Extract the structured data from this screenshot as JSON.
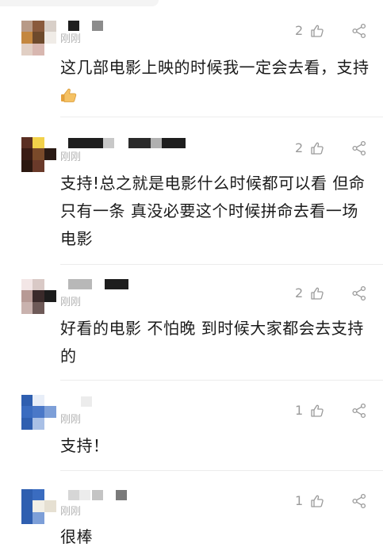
{
  "comments": [
    {
      "time": "刚刚",
      "likes": "2",
      "content": "这几部电影上映的时候我一定会去看，支持"
    },
    {
      "time": "刚刚",
      "likes": "2",
      "content": "支持!总之就是电影什么时候都可以看 但命只有一条 真没必要这个时候拼命去看一场电影"
    },
    {
      "time": "刚刚",
      "likes": "2",
      "content": "好看的电影 不怕晚 到时候大家都会去支持的"
    },
    {
      "time": "刚刚",
      "likes": "1",
      "content": "支持！"
    },
    {
      "time": "刚刚",
      "likes": "1",
      "content": "很棒"
    }
  ],
  "icons": {
    "like": "thumb-up-outline-icon",
    "share": "share-icon",
    "emoji": "thumbs-up-emoji"
  },
  "colors": {
    "text": "#1b1b1b",
    "meta": "#b4b4b4",
    "likes": "#9a9a9a",
    "divider": "#ececec"
  }
}
